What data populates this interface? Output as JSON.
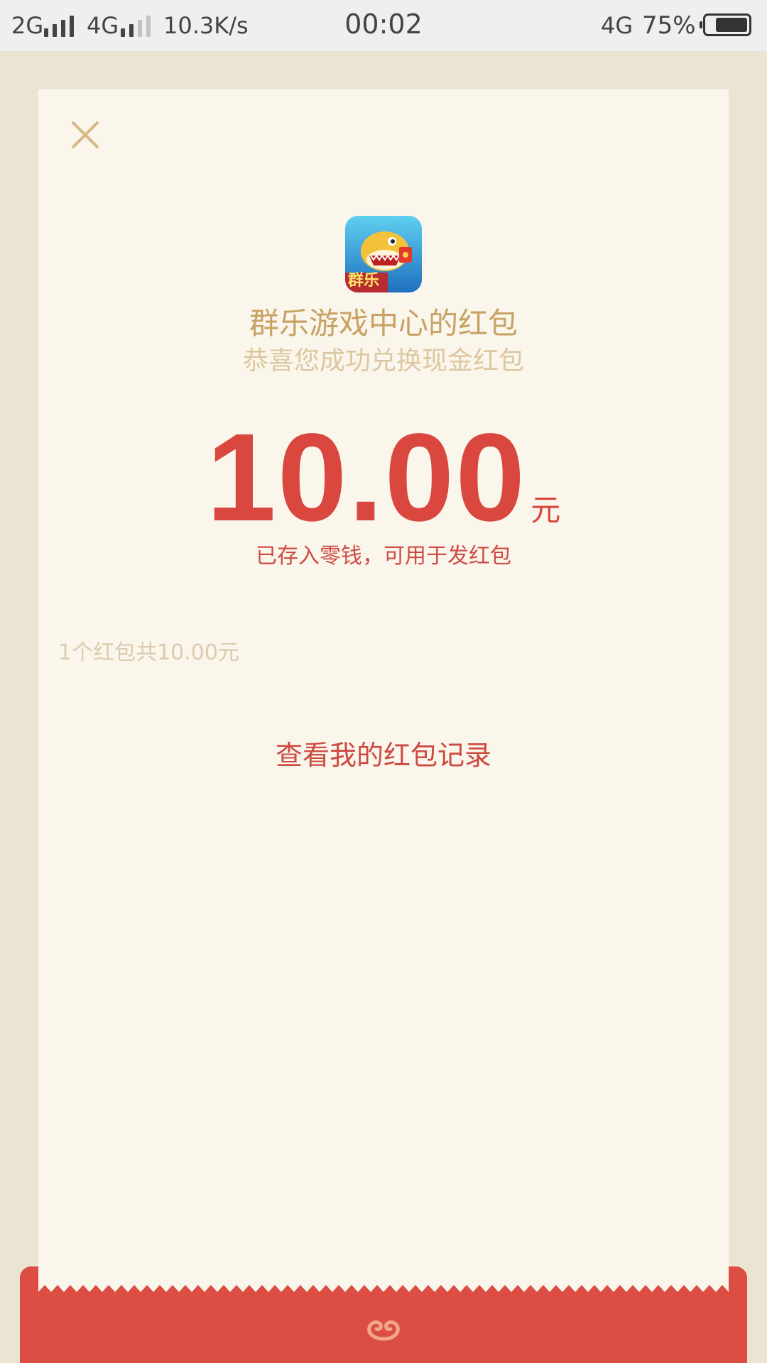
{
  "status_bar": {
    "network1": "2G",
    "network2": "4G",
    "speed": "10.3K/s",
    "time": "00:02",
    "network3": "4G",
    "battery": "75%"
  },
  "card": {
    "sender": "群乐游戏中心的红包",
    "subtitle": "恭喜您成功兑换现金红包",
    "amount": "10.00",
    "unit": "元",
    "deposit_note": "已存入零钱，可用于发红包",
    "summary": "1个红包共10.00元",
    "records_link": "查看我的红包记录",
    "icon_label": "群乐"
  },
  "colors": {
    "accent_red": "#d9473f",
    "gold": "#c8a264",
    "background": "#ece4d2",
    "card": "#faf6ec"
  }
}
